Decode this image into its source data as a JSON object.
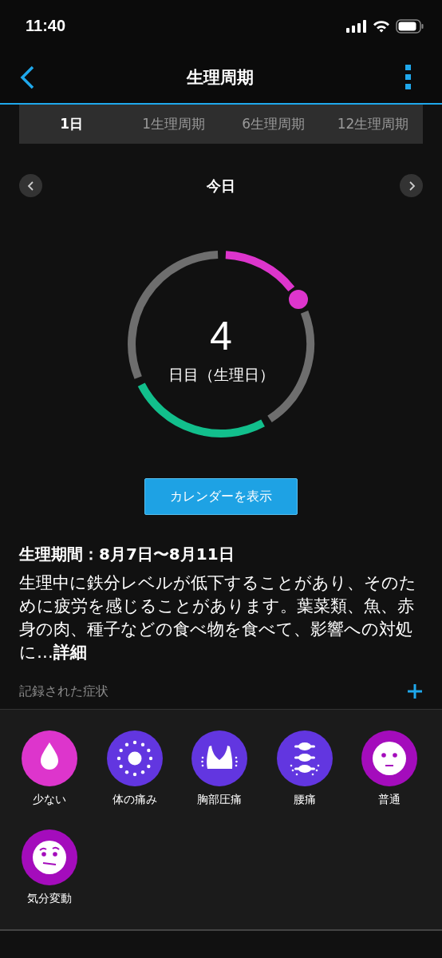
{
  "status_bar": {
    "time": "11:40"
  },
  "header": {
    "title": "生理周期"
  },
  "tabs": [
    {
      "label": "1日",
      "selected": true
    },
    {
      "label": "1生理周期",
      "selected": false
    },
    {
      "label": "6生理周期",
      "selected": false
    },
    {
      "label": "12生理周期",
      "selected": false
    }
  ],
  "date_nav": {
    "label": "今日"
  },
  "ring": {
    "day": "4",
    "caption": "日目（生理日）"
  },
  "calendar_button": {
    "label": "カレンダーを表示"
  },
  "period": {
    "title": "生理期間：8月7日〜8月11日",
    "body": "生理中に鉄分レベルが低下することがあり、そのために疲労を感じることがあります。葉菜類、魚、赤身の肉、種子などの食べ物を食べて、影響への対処に…**詳細**"
  },
  "symptoms_header": {
    "label": "記録された症状"
  },
  "symptoms": [
    {
      "kind": "drop",
      "label": "少ない",
      "color": "#dd35cc"
    },
    {
      "kind": "body",
      "label": "体の痛み",
      "color": "#6236e0"
    },
    {
      "kind": "bra",
      "label": "胸部圧痛",
      "color": "#6236e0"
    },
    {
      "kind": "spine",
      "label": "腰痛",
      "color": "#6236e0"
    },
    {
      "kind": "neutral",
      "label": "普通",
      "color": "#a40cbc"
    },
    {
      "kind": "moody",
      "label": "気分変動",
      "color": "#a40cbc"
    }
  ]
}
